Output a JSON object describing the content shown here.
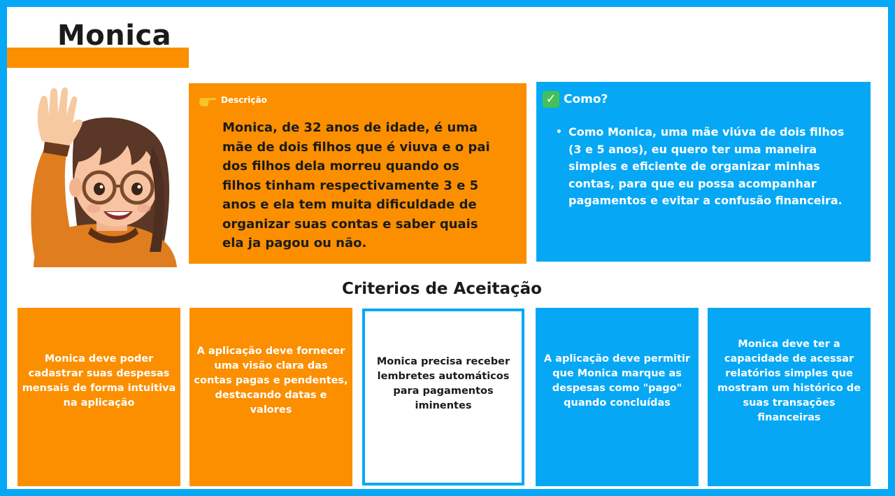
{
  "persona": {
    "name": "Monica"
  },
  "description": {
    "icon": "pointing-hand-icon",
    "label": "Descrição",
    "text": "Monica, de 32 anos de idade, é uma mãe de dois filhos que é viuva e o pai dos filhos dela morreu quando os filhos tinham respectivamente 3 e 5 anos e ela tem muita dificuldade de organizar suas contas e saber quais ela ja pagou ou não."
  },
  "como": {
    "icon": "check-mark-icon",
    "label": "Como?",
    "bullet": "•",
    "text": "Como Monica, uma mãe viúva de dois filhos (3 e 5 anos), eu quero ter uma maneira simples e eficiente de organizar minhas contas, para que eu possa acompanhar pagamentos e evitar a confusão financeira."
  },
  "criteria": {
    "title": "Criterios de Aceitação",
    "items": [
      {
        "text": "Monica deve poder cadastrar suas despesas mensais de forma intuitiva na aplicação"
      },
      {
        "text": "A aplicação deve fornecer uma visão clara das contas pagas e pendentes, destacando datas e valores"
      },
      {
        "text": "Monica precisa receber lembretes automáticos para pagamentos iminentes"
      },
      {
        "text": "A aplicação deve permitir que Monica marque as despesas como \"pago\" quando concluídas"
      },
      {
        "text": "Monica deve ter a capacidade de acessar relatórios simples que mostram um histórico de suas transações financeiras"
      }
    ]
  },
  "colors": {
    "orange": "#fb8f00",
    "blue": "#06a8f5",
    "text_dark": "#1b1b1b",
    "white": "#ffffff"
  }
}
